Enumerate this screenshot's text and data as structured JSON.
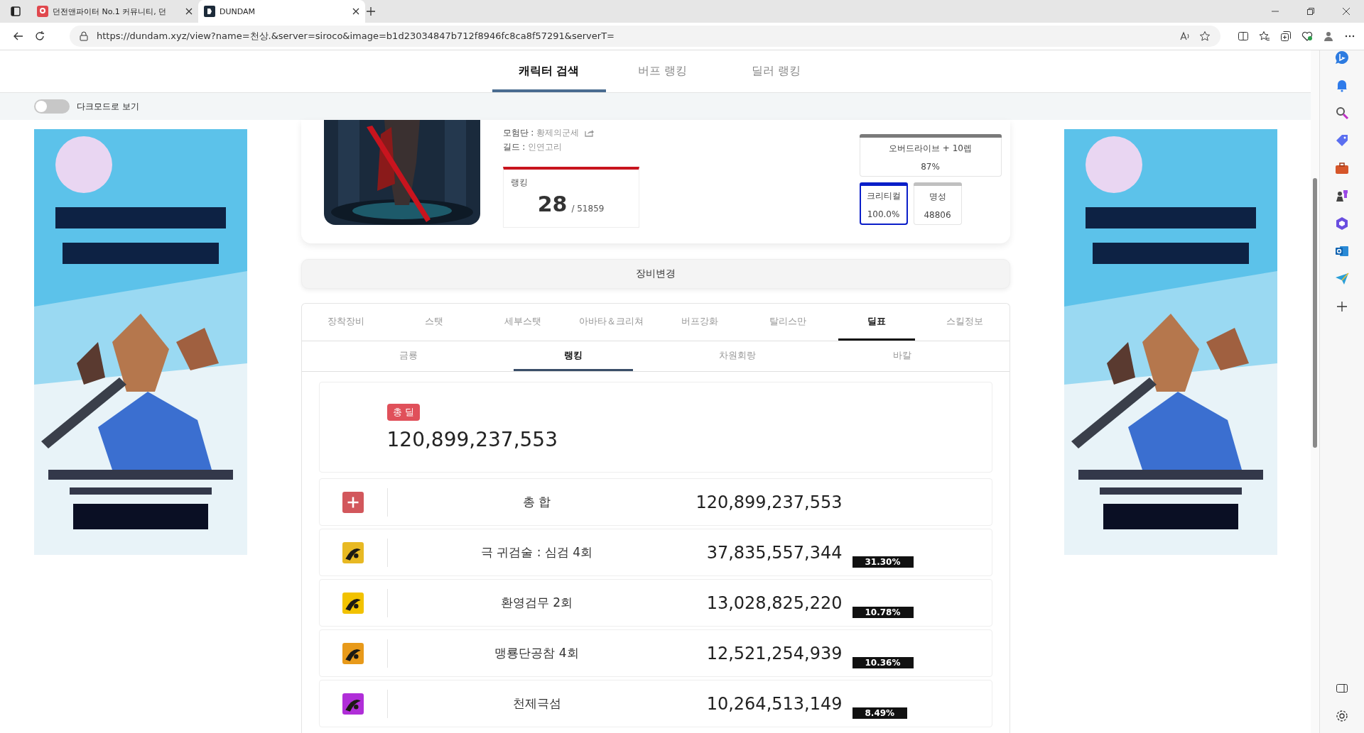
{
  "browser": {
    "tabs": [
      {
        "title": "던전앤파이터 No.1 커뮤니티, 던",
        "selected": false
      },
      {
        "title": "DUNDAM",
        "selected": true
      }
    ],
    "url": "https://dundam.xyz/view?name=천상.&server=siroco&image=b1d23034847b712f8946fc8ca8f57291&serverT="
  },
  "nav": {
    "tabs": [
      {
        "label": "캐릭터 검색",
        "selected": true
      },
      {
        "label": "버프 랭킹",
        "selected": false
      },
      {
        "label": "딜러 랭킹",
        "selected": false
      }
    ]
  },
  "dark_mode": {
    "label": "다크모드로 보기",
    "on": false
  },
  "profile": {
    "adventure_label": "모험단 :",
    "adventure": "황제의군세",
    "guild_label": "길드 :",
    "guild": "인연고리",
    "ranking": {
      "label": "랭킹",
      "rank": "28",
      "total": "/ 51859"
    },
    "stats": [
      {
        "label": "오버드라이브 + 10렙",
        "value": "87%",
        "color": "#7a7a7a",
        "highlighted": false
      },
      {
        "label": "크리티컬",
        "value": "100.0%",
        "color": "#0a1ec8",
        "highlighted": true
      },
      {
        "label": "명성",
        "value": "48806",
        "color": "#c0c0c0",
        "highlighted": false
      }
    ]
  },
  "equipment_button": "장비변경",
  "tabs": [
    {
      "label": "장착장비",
      "selected": false
    },
    {
      "label": "스탯",
      "selected": false
    },
    {
      "label": "세부스탯",
      "selected": false
    },
    {
      "label": "아바타＆크리쳐",
      "selected": false
    },
    {
      "label": "버프강화",
      "selected": false
    },
    {
      "label": "탈리스만",
      "selected": false
    },
    {
      "label": "딜표",
      "selected": true
    },
    {
      "label": "스킬정보",
      "selected": false
    }
  ],
  "subtabs": [
    {
      "label": "금룡",
      "selected": false
    },
    {
      "label": "랭킹",
      "selected": true
    },
    {
      "label": "차원회랑",
      "selected": false
    },
    {
      "label": "바칼",
      "selected": false
    }
  ],
  "total": {
    "badge": "총 딜",
    "value": "120,899,237,553"
  },
  "rows": [
    {
      "kind": "sum",
      "name": "총 합",
      "value": "120,899,237,553"
    },
    {
      "kind": "skill",
      "color": "#e8b923",
      "name": "극 귀검술 : 심검 4회",
      "value": "37,835,557,344",
      "percent": "31.30%"
    },
    {
      "kind": "skill",
      "color": "#f2c200",
      "name": "환영검무 2회",
      "value": "13,028,825,220",
      "percent": "10.78%"
    },
    {
      "kind": "skill",
      "color": "#e89a1a",
      "name": "맹룡단공참 4회",
      "value": "12,521,254,939",
      "percent": "10.36%"
    },
    {
      "kind": "skill",
      "color": "#b02ed8",
      "name": "천제극섬",
      "value": "10,264,513,149",
      "percent": "8.49%"
    }
  ]
}
